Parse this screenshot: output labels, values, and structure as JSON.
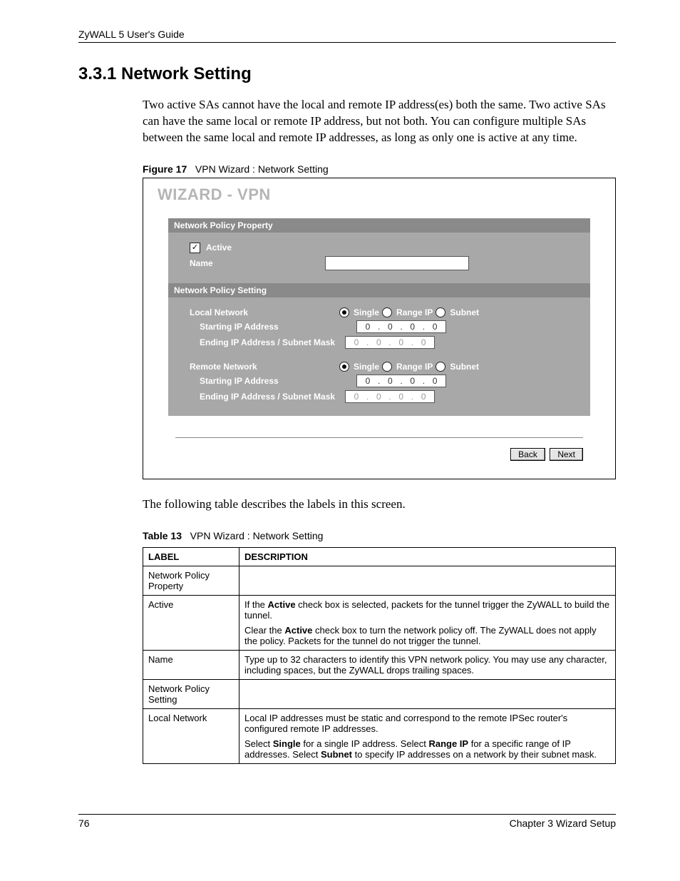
{
  "header": {
    "doc_title": "ZyWALL 5 User's Guide"
  },
  "section": {
    "number_title": "3.3.1  Network Setting",
    "paragraph1": "Two active SAs cannot have the local and remote IP address(es) both the same. Two active SAs can have the same local or remote IP address, but not both. You can configure multiple SAs between the same local and remote IP addresses, as long as only one is active at any time.",
    "paragraph2": "The following table describes the labels in this screen."
  },
  "figure": {
    "label": "Figure 17",
    "title": "VPN Wizard : Network Setting",
    "wizard_title": "WIZARD - VPN",
    "bars": {
      "property": "Network Policy Property",
      "setting": "Network Policy Setting"
    },
    "fields": {
      "active": "Active",
      "name": "Name",
      "local_network": "Local Network",
      "remote_network": "Remote Network",
      "starting_ip": "Starting IP Address",
      "ending_ip": "Ending IP Address / Subnet Mask"
    },
    "radios": {
      "single": "Single",
      "range": "Range IP",
      "subnet": "Subnet"
    },
    "ip_default": {
      "a": "0",
      "b": "0",
      "c": "0",
      "d": "0"
    },
    "buttons": {
      "back": "Back",
      "next": "Next"
    }
  },
  "table": {
    "label": "Table 13",
    "title": "VPN Wizard : Network Setting",
    "headers": {
      "label": "LABEL",
      "desc": "DESCRIPTION"
    },
    "rows": {
      "r0": {
        "label": "Network Policy Property",
        "desc": ""
      },
      "r1": {
        "label": "Active",
        "desc_a": "If the ",
        "desc_b": "Active",
        "desc_c": " check box is selected, packets for the tunnel trigger the ZyWALL to build the tunnel.",
        "desc_d": "Clear the ",
        "desc_e": "Active",
        "desc_f": " check box to turn the network policy off. The ZyWALL does not apply the policy. Packets for the tunnel do not trigger the tunnel."
      },
      "r2": {
        "label": "Name",
        "desc": "Type up to 32 characters to identify this VPN network policy. You may use any character, including spaces, but the ZyWALL drops trailing spaces."
      },
      "r3": {
        "label": "Network Policy Setting",
        "desc": ""
      },
      "r4": {
        "label": "Local Network",
        "desc_a": "Local IP addresses must be static and correspond to the remote IPSec router's configured remote IP addresses.",
        "desc_b": "Select ",
        "desc_c": "Single",
        "desc_d": " for a single IP address. Select ",
        "desc_e": "Range IP",
        "desc_f": " for a specific range of IP addresses. Select ",
        "desc_g": "Subnet",
        "desc_h": " to specify IP addresses on a network by their subnet mask."
      }
    }
  },
  "footer": {
    "page": "76",
    "chapter": "Chapter 3 Wizard Setup"
  }
}
